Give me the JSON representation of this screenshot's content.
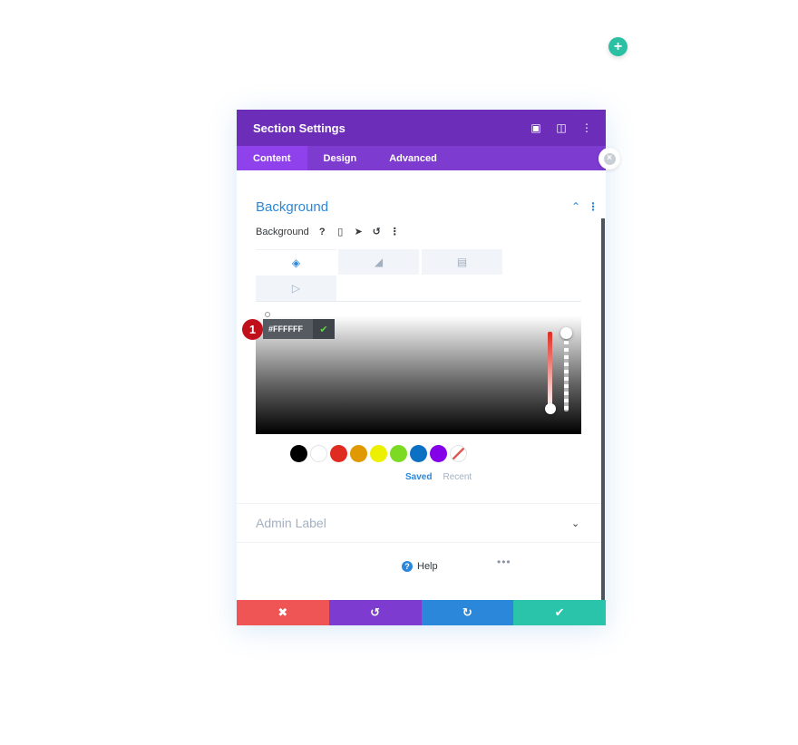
{
  "modal": {
    "title": "Section Settings",
    "tabs": [
      {
        "label": "Content",
        "active": true
      },
      {
        "label": "Design",
        "active": false
      },
      {
        "label": "Advanced",
        "active": false
      }
    ]
  },
  "background_section": {
    "heading": "Background",
    "field_label": "Background",
    "type_tabs": [
      {
        "icon": "paint-bucket-icon",
        "active": true
      },
      {
        "icon": "gradient-icon",
        "active": false
      },
      {
        "icon": "image-icon",
        "active": false
      },
      {
        "icon": "video-icon",
        "active": false
      }
    ]
  },
  "color_picker": {
    "hex_value": "#FFFFFF",
    "step_number": "1",
    "swatches": [
      "#000000",
      "#ffffff",
      "#e02b20",
      "#e09900",
      "#edf000",
      "#7cda24",
      "#0c71c3",
      "#8300e9"
    ],
    "palette_tabs": [
      {
        "label": "Saved",
        "active": true
      },
      {
        "label": "Recent",
        "active": false
      }
    ]
  },
  "admin_label": {
    "heading": "Admin Label"
  },
  "help": {
    "label": "Help"
  },
  "colors": {
    "header": "#6c2eb9",
    "tabs": "#7e3bd0",
    "cancel": "#ef5555",
    "undo": "#7e3bd0",
    "redo": "#2b87da",
    "save": "#29c4a9",
    "accent": "#2b87da"
  }
}
